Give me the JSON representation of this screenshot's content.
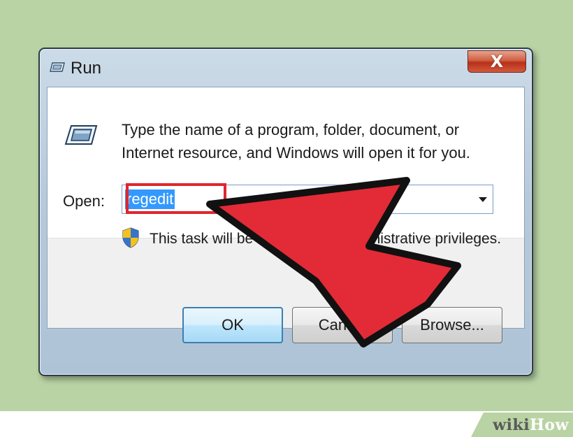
{
  "window": {
    "title": "Run",
    "close_glyph": "X"
  },
  "dialog": {
    "description": "Type the name of a program, folder, document, or Internet resource, and Windows will open it for you.",
    "open_label": "Open:",
    "open_value": "regedit",
    "privilege_note": "This task will be created with administrative privileges."
  },
  "buttons": {
    "ok": "OK",
    "cancel": "Cancel",
    "browse": "Browse..."
  },
  "watermark": {
    "part1": "wiki",
    "part2": "How"
  },
  "icons": [
    "run-icon",
    "shield-icon",
    "chevron-down-icon",
    "close-icon"
  ],
  "colors": {
    "background": "#b9d3a4",
    "highlight": "#3399ff",
    "annotation_red": "#e0262f"
  }
}
